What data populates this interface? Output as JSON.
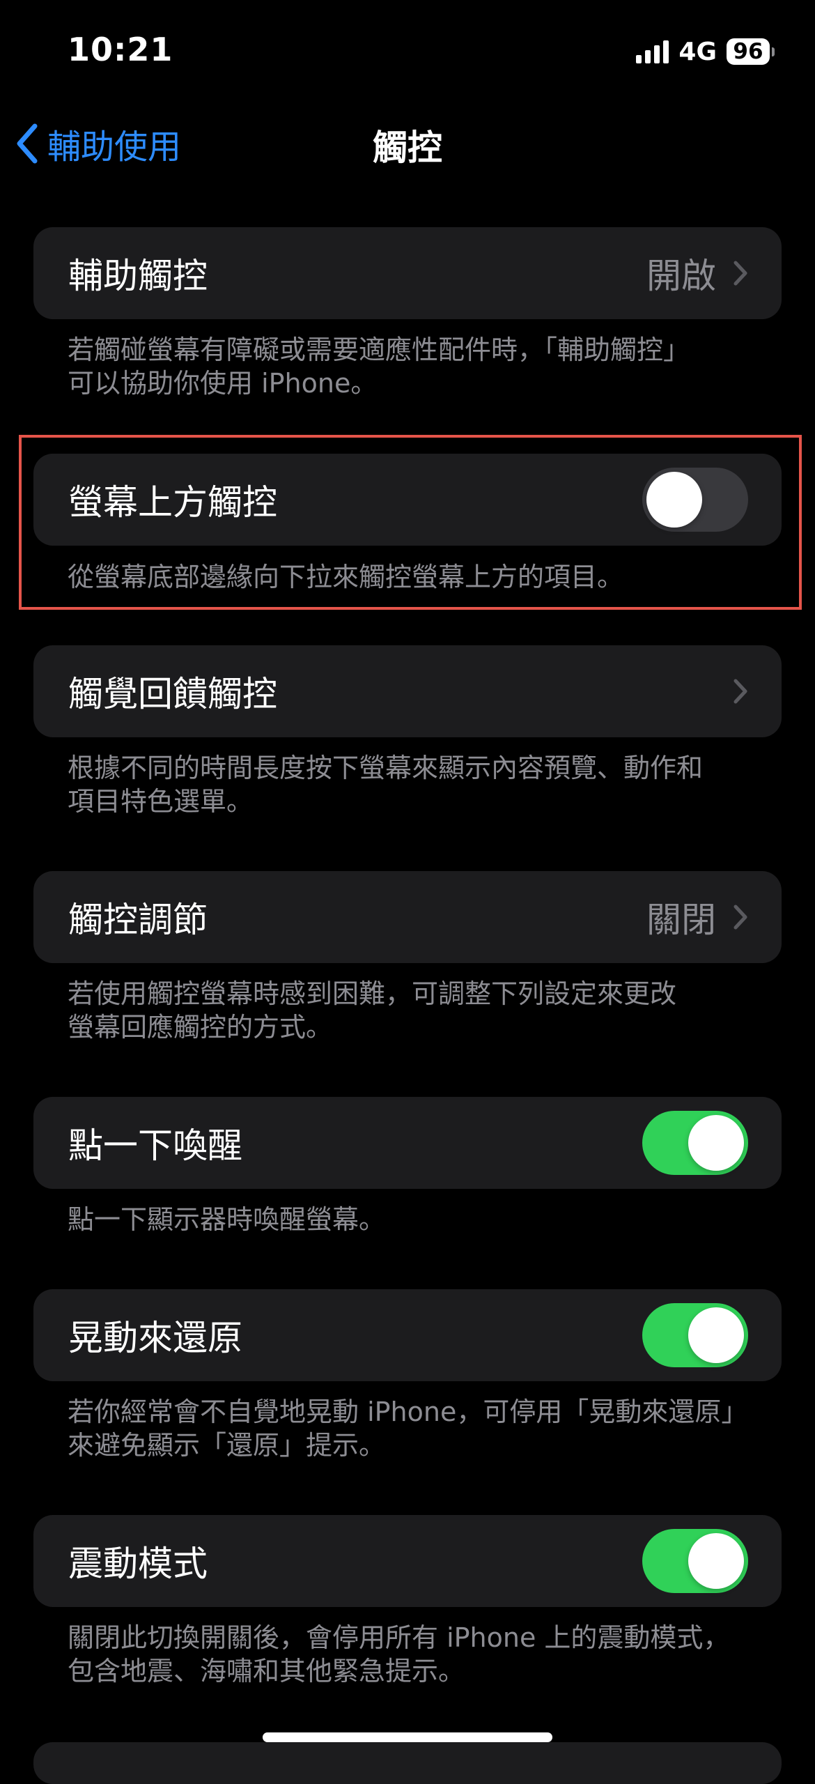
{
  "status_bar": {
    "time": "10:21",
    "network": "4G",
    "battery": "96"
  },
  "nav": {
    "back_label": "輔助使用",
    "title": "觸控"
  },
  "rows": [
    {
      "label": "輔助觸控",
      "value": "開啟",
      "type": "disclosure",
      "footnote_lines": [
        "若觸碰螢幕有障礙或需要適應性配件時，「輔助觸控」",
        "可以協助你使用 iPhone。"
      ]
    },
    {
      "label": "螢幕上方觸控",
      "type": "toggle",
      "toggle_on": false,
      "footnote_lines": [
        "從螢幕底部邊緣向下拉來觸控螢幕上方的項目。"
      ]
    },
    {
      "label": "觸覺回饋觸控",
      "type": "disclosure",
      "footnote_lines": [
        "根據不同的時間長度按下螢幕來顯示內容預覽、動作和",
        "項目特色選單。"
      ]
    },
    {
      "label": "觸控調節",
      "value": "關閉",
      "type": "disclosure",
      "footnote_lines": [
        "若使用觸控螢幕時感到困難，可調整下列設定來更改",
        "螢幕回應觸控的方式。"
      ]
    },
    {
      "label": "點一下喚醒",
      "type": "toggle",
      "toggle_on": true,
      "footnote_lines": [
        "點一下顯示器時喚醒螢幕。"
      ]
    },
    {
      "label": "晃動來還原",
      "type": "toggle",
      "toggle_on": true,
      "footnote_lines": [
        "若你經常會不自覺地晃動 iPhone，可停用「晃動來還原」",
        "來避免顯示「還原」提示。"
      ]
    },
    {
      "label": "震動模式",
      "type": "toggle",
      "toggle_on": true,
      "footnote_lines": [
        "關閉此切換開關後，會停用所有 iPhone 上的震動模式，",
        "包含地震、海嘯和其他緊急提示。"
      ]
    }
  ],
  "colors": {
    "accent": "#2d8cff",
    "toggle_on": "#30d158",
    "toggle_off": "#39393d",
    "card_bg": "#1c1c1e",
    "secondary_text": "#8d8d93",
    "highlight": "#e5544a"
  },
  "icons": [
    "chevron-left-icon",
    "chevron-right-icon",
    "signal-icon",
    "battery-icon"
  ]
}
